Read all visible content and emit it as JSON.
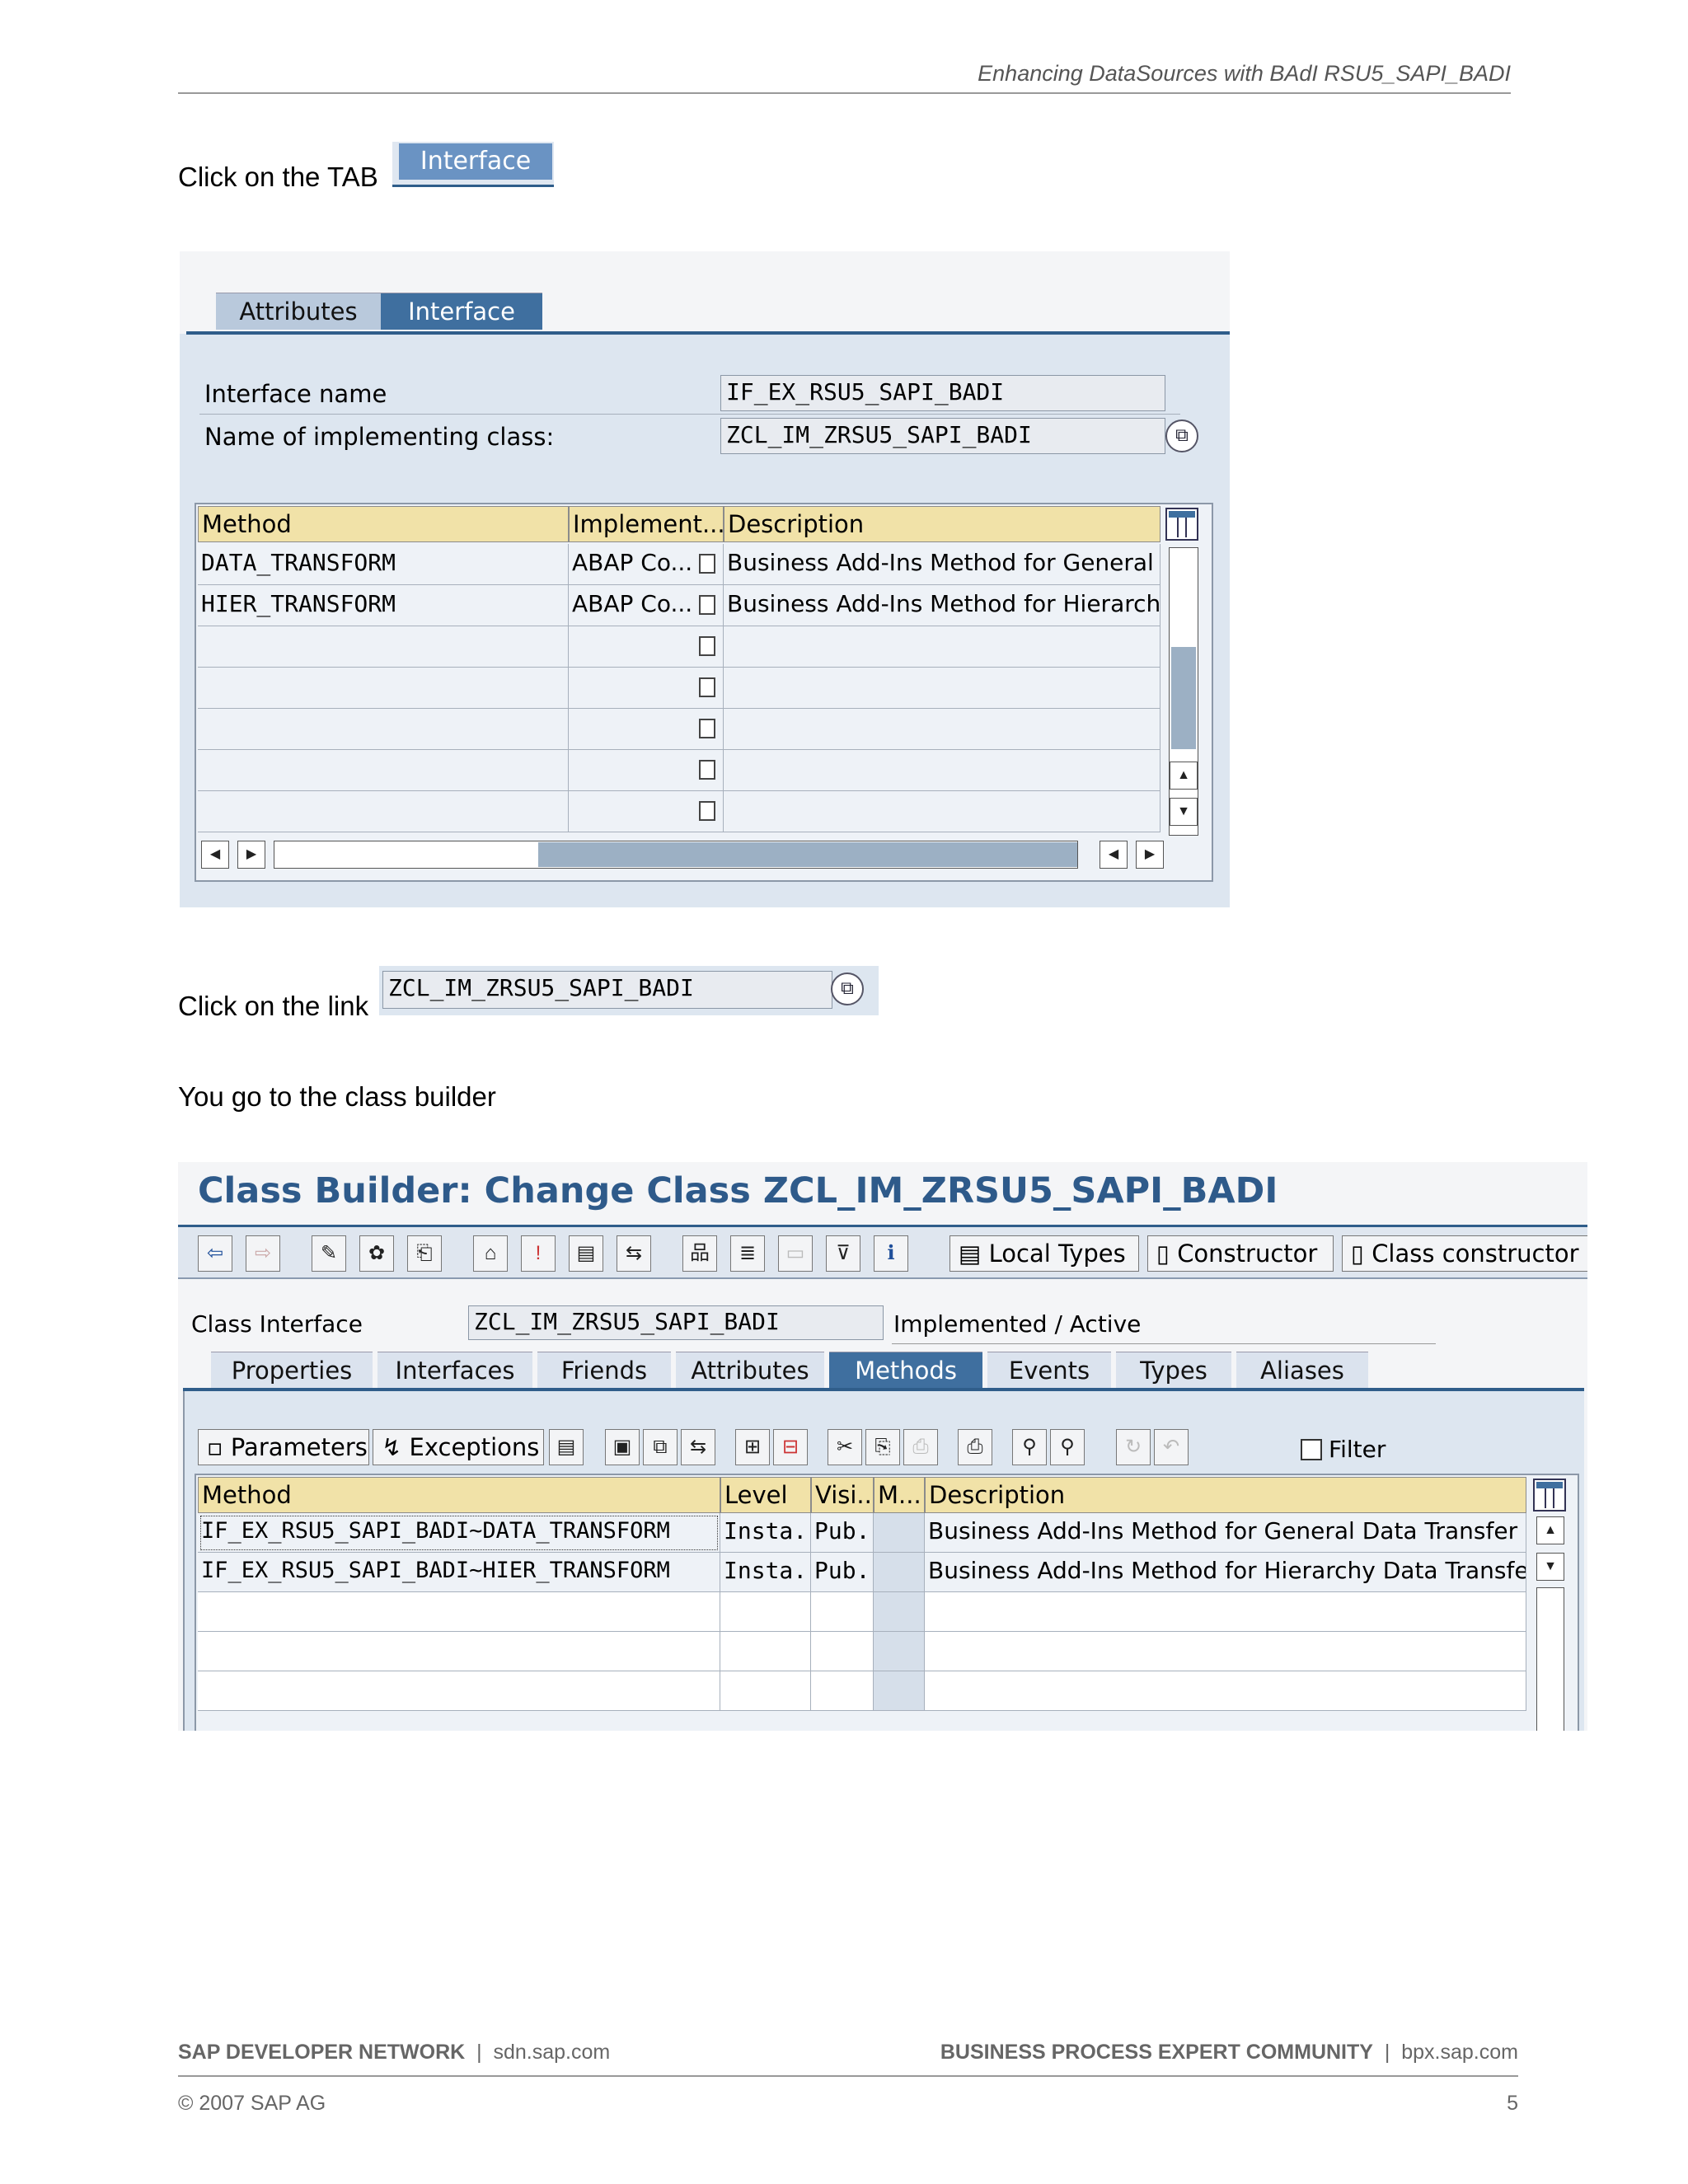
{
  "header": {
    "title": "Enhancing DataSources with BAdI RSU5_SAPI_BADI"
  },
  "step1": {
    "text": "Click on the TAB",
    "tab_label": "Interface"
  },
  "screen1": {
    "tabs": [
      "Attributes",
      "Interface"
    ],
    "interface_name_label": "Interface name",
    "interface_name_value": "IF_EX_RSU5_SAPI_BADI",
    "impl_class_label": "Name of implementing class:",
    "impl_class_value": "ZCL_IM_ZRSU5_SAPI_BADI",
    "columns": [
      "Method",
      "Implement...",
      "Description"
    ],
    "rows": [
      {
        "method": "DATA_TRANSFORM",
        "impl": "ABAP Co...",
        "desc": "Business Add-Ins Method for General"
      },
      {
        "method": "HIER_TRANSFORM",
        "impl": "ABAP Co...",
        "desc": "Business Add-Ins Method for Hierarch"
      }
    ]
  },
  "step2": {
    "text": "Click on the link",
    "link_value": "ZCL_IM_ZRSU5_SAPI_BADI"
  },
  "step3": {
    "text": "You go to the class builder"
  },
  "screen2": {
    "title": "Class Builder: Change Class ZCL_IM_ZRSU5_SAPI_BADI",
    "toolbar_text_buttons": [
      "Local Types",
      "Constructor",
      "Class constructor"
    ],
    "class_interface_label": "Class Interface",
    "class_interface_value": "ZCL_IM_ZRSU5_SAPI_BADI",
    "status": "Implemented / Active",
    "tabs": [
      "Properties",
      "Interfaces",
      "Friends",
      "Attributes",
      "Methods",
      "Events",
      "Types",
      "Aliases"
    ],
    "active_tab": "Methods",
    "params_button": "Parameters",
    "exceptions_button": "Exceptions",
    "filter_label": "Filter",
    "columns": [
      "Method",
      "Level",
      "Visi...",
      "M...",
      "Description"
    ],
    "rows": [
      {
        "method": "IF_EX_RSU5_SAPI_BADI~DATA_TRANSFORM",
        "level": "Insta...",
        "vis": "Pub...",
        "desc": "Business Add-Ins Method for General Data Transfer"
      },
      {
        "method": "IF_EX_RSU5_SAPI_BADI~HIER_TRANSFORM",
        "level": "Insta...",
        "vis": "Pub...",
        "desc": "Business Add-Ins Method for Hierarchy Data Transfer"
      }
    ]
  },
  "footer": {
    "left_bold": "SAP DEVELOPER NETWORK",
    "left_url": "sdn.sap.com",
    "right_bold": "BUSINESS PROCESS EXPERT COMMUNITY",
    "right_url": "bpx.sap.com",
    "copyright": "© 2007 SAP AG",
    "page_number": "5"
  }
}
